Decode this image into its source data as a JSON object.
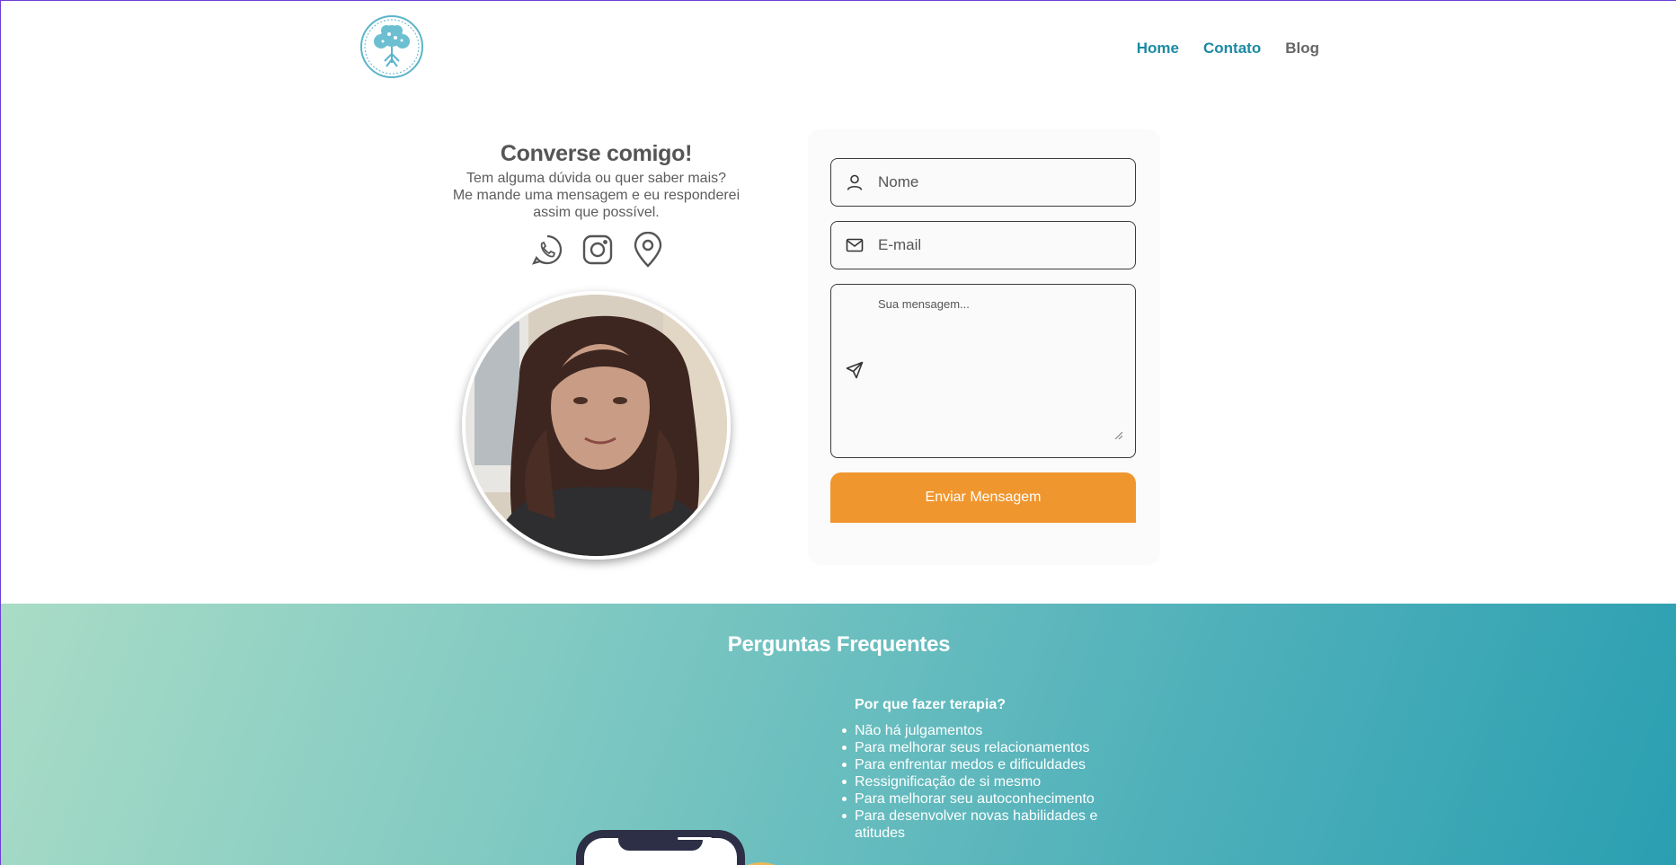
{
  "header": {
    "logo_icon": "tree-of-life-icon",
    "nav": [
      {
        "label": "Home"
      },
      {
        "label": "Contato"
      },
      {
        "label": "Blog"
      }
    ]
  },
  "contact": {
    "title": "Converse comigo!",
    "line1": "Tem alguma dúvida ou quer saber mais?",
    "line2": "Me mande uma mensagem e eu responderei",
    "line3": "assim que possível.",
    "socials": [
      "whatsapp-icon",
      "instagram-icon",
      "location-pin-icon"
    ]
  },
  "form": {
    "name_placeholder": "Nome",
    "email_placeholder": "E-mail",
    "message_placeholder": "Sua mensagem...",
    "submit_label": "Enviar Mensagem"
  },
  "faq": {
    "title": "Perguntas Frequentes",
    "question": "Por que fazer terapia?",
    "items": [
      "Não há julgamentos",
      "Para melhorar seus relacionamentos",
      "Para enfrentar medos e dificuldades",
      "Ressignificação de si mesmo",
      "Para melhorar seu autoconhecimento",
      "Para desenvolver novas habilidades e atitudes"
    ]
  },
  "colors": {
    "accent": "#1c8aa3",
    "button": "#f0962e",
    "faq_gradient_start": "#a9dcc6",
    "faq_gradient_end": "#2a9fb1"
  }
}
